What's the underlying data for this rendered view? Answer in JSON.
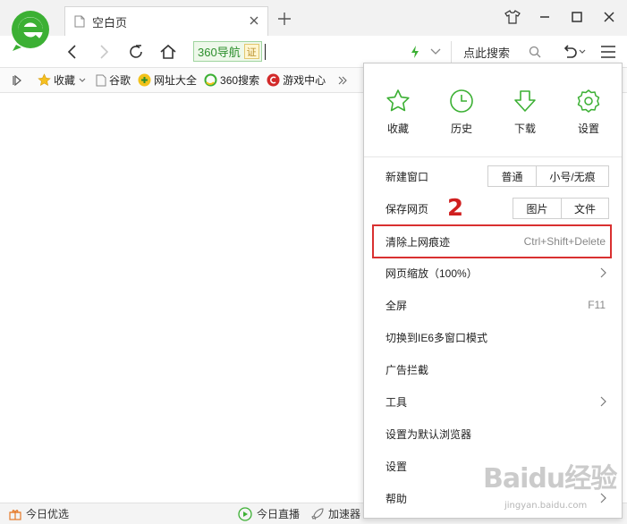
{
  "tab": {
    "title": "空白页"
  },
  "navbar": {
    "badge_text": "360导航",
    "verify_text": "证",
    "search_text": "点此搜索"
  },
  "bookmarks": [
    {
      "label": "收藏",
      "icon": "star-icon"
    },
    {
      "label": "谷歌",
      "icon": "page-icon"
    },
    {
      "label": "网址大全",
      "icon": "360-nav-icon"
    },
    {
      "label": "360搜索",
      "icon": "360-search-icon"
    },
    {
      "label": "游戏中心",
      "icon": "game-center-icon"
    }
  ],
  "menu": {
    "quick": [
      {
        "label": "收藏",
        "icon": "star-icon"
      },
      {
        "label": "历史",
        "icon": "clock-icon"
      },
      {
        "label": "下载",
        "icon": "download-icon"
      },
      {
        "label": "设置",
        "icon": "gear-icon"
      }
    ],
    "new_window": {
      "label": "新建窗口",
      "options": [
        "普通",
        "小号/无痕"
      ]
    },
    "save_page": {
      "label": "保存网页",
      "options": [
        "图片",
        "文件"
      ]
    },
    "clear_history": {
      "label": "清除上网痕迹",
      "shortcut": "Ctrl+Shift+Delete"
    },
    "zoom": {
      "label": "网页缩放（100%）"
    },
    "fullscreen": {
      "label": "全屏",
      "shortcut": "F11"
    },
    "ie6_mode": {
      "label": "切换到IE6多窗口模式"
    },
    "ad_block": {
      "label": "广告拦截"
    },
    "tools": {
      "label": "工具"
    },
    "default_browser": {
      "label": "设置为默认浏览器"
    },
    "settings": {
      "label": "设置"
    },
    "help": {
      "label": "帮助"
    }
  },
  "annotation": {
    "step": "2"
  },
  "statusbar": {
    "left": "今日优选",
    "live": "今日直播",
    "accel": "加速器"
  },
  "watermark": {
    "logo": "Baidu经验",
    "url": "jingyan.baidu.com"
  },
  "colors": {
    "accent_green": "#3cb034",
    "highlight_red": "#d93030"
  }
}
